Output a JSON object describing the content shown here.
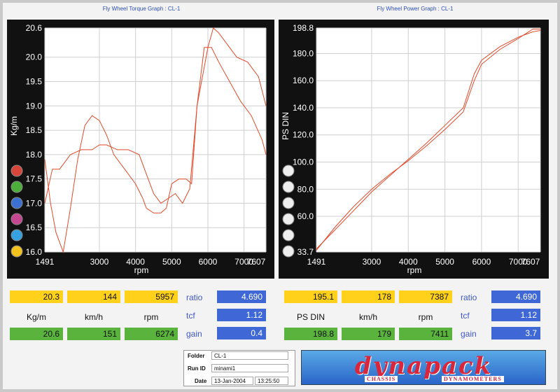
{
  "left_panel": {
    "title": "Fly Wheel Torque Graph : CL-1",
    "readouts": {
      "top": [
        {
          "value": "20.3",
          "color": "yellow"
        },
        {
          "value": "144",
          "color": "yellow"
        },
        {
          "value": "5957",
          "color": "yellow"
        }
      ],
      "units": [
        "Kg/m",
        "km/h",
        "rpm"
      ],
      "bottom": [
        {
          "value": "20.6",
          "color": "green"
        },
        {
          "value": "151",
          "color": "green"
        },
        {
          "value": "6274",
          "color": "green"
        }
      ],
      "right_labels": [
        "ratio",
        "tcf",
        "gain"
      ],
      "right_values": [
        "4.690",
        "1.12",
        "0.4"
      ]
    },
    "legend_dots": [
      "#d8453a",
      "#4caf3c",
      "#3b6fd1",
      "#c4478f",
      "#36a3e0",
      "#f3c21c"
    ]
  },
  "right_panel": {
    "title": "Fly Wheel Power Graph : CL-1",
    "readouts": {
      "top": [
        {
          "value": "195.1",
          "color": "yellow"
        },
        {
          "value": "178",
          "color": "yellow"
        },
        {
          "value": "7387",
          "color": "yellow"
        }
      ],
      "units": [
        "PS DIN",
        "km/h",
        "rpm"
      ],
      "bottom": [
        {
          "value": "198.8",
          "color": "green"
        },
        {
          "value": "179",
          "color": "green"
        },
        {
          "value": "7411",
          "color": "green"
        }
      ],
      "right_labels": [
        "ratio",
        "tcf",
        "gain"
      ],
      "right_values": [
        "4.690",
        "1.12",
        "3.7"
      ]
    },
    "legend_dots": [
      "#eeeeee",
      "#eeeeee",
      "#eeeeee",
      "#eeeeee",
      "#eeeeee",
      "#eeeeee"
    ]
  },
  "footer": {
    "folder_label": "Folder",
    "folder_value": "CL-1",
    "runid_label": "Run ID",
    "runid_value": "minami1",
    "date_label": "Date",
    "date_value": "13-Jan-2004",
    "time_value": "13:25:50"
  },
  "logo": {
    "word": "dynapack",
    "sub_left": "CHASSIS",
    "sub_right": "DYNAMOMETERS"
  },
  "chart_data": [
    {
      "type": "line",
      "title": "Fly Wheel Torque Graph : CL-1",
      "xlabel": "rpm",
      "ylabel": "Kg/m",
      "xlim": [
        1491,
        7607
      ],
      "ylim": [
        16.0,
        20.6
      ],
      "xticks": [
        "1491",
        "3000",
        "4000",
        "5000",
        "6000",
        "7000",
        "7607"
      ],
      "yticks": [
        "20.6",
        "20.0",
        "19.5",
        "19.0",
        "18.5",
        "18.0",
        "17.5",
        "17.0",
        "16.5",
        "16.0"
      ],
      "grid": true,
      "color": "#e34a2a",
      "series": [
        {
          "x": [
            1491,
            1650,
            1800,
            2000,
            2200,
            2400,
            2600,
            2800,
            3000,
            3200,
            3400,
            3600,
            3800,
            4000,
            4200,
            4300,
            4500,
            4700,
            4850,
            5000,
            5200,
            5400,
            5550,
            5700,
            6000,
            6150,
            6300,
            6500,
            6800,
            7100,
            7400,
            7607
          ],
          "y": [
            17.9,
            17.0,
            16.4,
            16.0,
            16.9,
            17.9,
            18.6,
            18.8,
            18.7,
            18.4,
            18.0,
            17.8,
            17.6,
            17.4,
            17.1,
            16.9,
            16.8,
            16.8,
            16.9,
            17.4,
            17.5,
            17.5,
            17.4,
            19.0,
            20.2,
            20.6,
            20.5,
            20.3,
            20.0,
            19.9,
            19.6,
            19.0
          ]
        },
        {
          "x": [
            1491,
            1700,
            1900,
            2200,
            2500,
            2800,
            3000,
            3200,
            3500,
            3800,
            4100,
            4300,
            4500,
            4700,
            4900,
            5100,
            5300,
            5500,
            5700,
            5900,
            6100,
            6300,
            6600,
            6900,
            7200,
            7500,
            7607
          ],
          "y": [
            17.0,
            17.7,
            17.7,
            18.0,
            18.1,
            18.1,
            18.2,
            18.2,
            18.1,
            18.1,
            18.0,
            17.6,
            17.2,
            17.0,
            17.1,
            17.2,
            17.0,
            17.3,
            19.0,
            20.2,
            20.2,
            19.9,
            19.5,
            19.1,
            18.8,
            18.3,
            18.0
          ]
        }
      ]
    },
    {
      "type": "line",
      "title": "Fly Wheel Power Graph : CL-1",
      "xlabel": "rpm",
      "ylabel": "PS DIN",
      "xlim": [
        1491,
        7607
      ],
      "ylim": [
        33.7,
        198.8
      ],
      "xticks": [
        "1491",
        "3000",
        "4000",
        "5000",
        "6000",
        "7000",
        "7607"
      ],
      "yticks": [
        "198.8",
        "180.0",
        "160.0",
        "140.0",
        "120.0",
        "100.0",
        "80.0",
        "60.0",
        "33.7"
      ],
      "grid": true,
      "color": "#e34a2a",
      "series": [
        {
          "x": [
            1491,
            2000,
            2500,
            3000,
            3500,
            4000,
            4500,
            5000,
            5500,
            5800,
            6000,
            6500,
            7000,
            7400,
            7607
          ],
          "y": [
            36,
            50,
            64,
            78,
            90,
            102,
            114,
            127,
            140,
            165,
            175,
            185,
            192,
            196,
            197
          ]
        },
        {
          "x": [
            1491,
            2000,
            2500,
            3000,
            3500,
            4000,
            4500,
            5000,
            5500,
            5800,
            6000,
            6500,
            7000,
            7400,
            7607
          ],
          "y": [
            35,
            52,
            67,
            80,
            91,
            101,
            112,
            124,
            137,
            160,
            172,
            183,
            191,
            198,
            198
          ]
        }
      ]
    }
  ]
}
